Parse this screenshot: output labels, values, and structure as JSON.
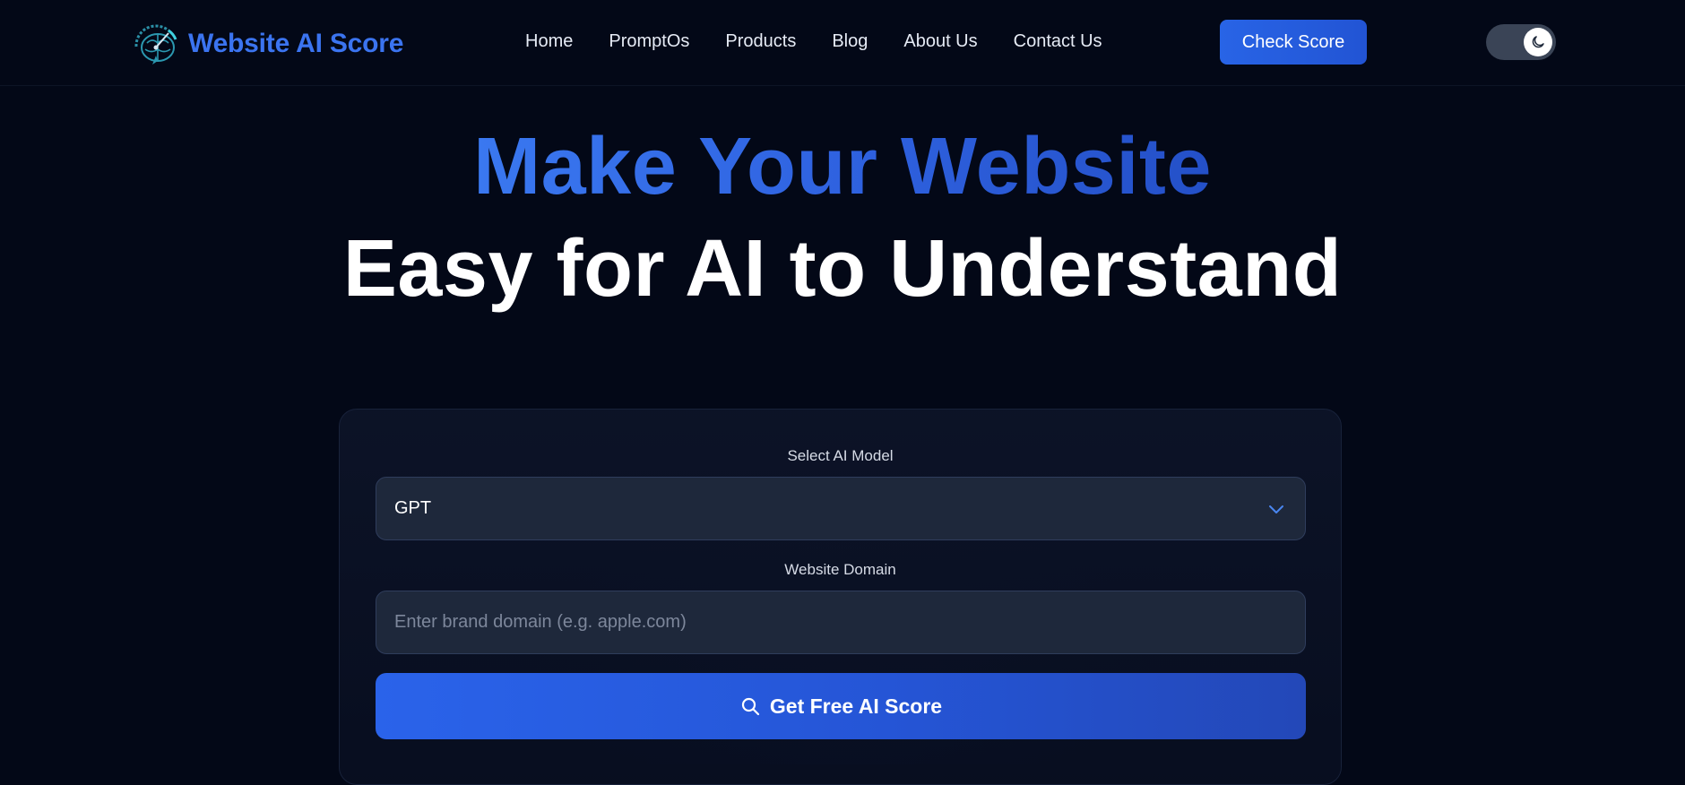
{
  "brand": {
    "name": "Website AI Score",
    "logo_icon": "brain-gauge-icon",
    "color": "#3b74f0"
  },
  "nav": {
    "items": [
      {
        "label": "Home"
      },
      {
        "label": "PromptOs"
      },
      {
        "label": "Products"
      },
      {
        "label": "Blog"
      },
      {
        "label": "About Us"
      },
      {
        "label": "Contact Us"
      }
    ],
    "cta_label": "Check Score",
    "theme_toggle_icon": "moon-icon",
    "theme": "dark"
  },
  "hero": {
    "headline_accent": "Make Your Website",
    "headline_main": "Easy for AI to Understand"
  },
  "form": {
    "model_label": "Select AI Model",
    "model_selected": "GPT",
    "domain_label": "Website Domain",
    "domain_value": "",
    "domain_placeholder": "Enter brand domain (e.g. apple.com)",
    "submit_label": "Get Free AI Score",
    "submit_icon": "search-icon"
  },
  "colors": {
    "background": "#030817",
    "accent": "#2a63ea",
    "input_bg": "#1e283b"
  }
}
